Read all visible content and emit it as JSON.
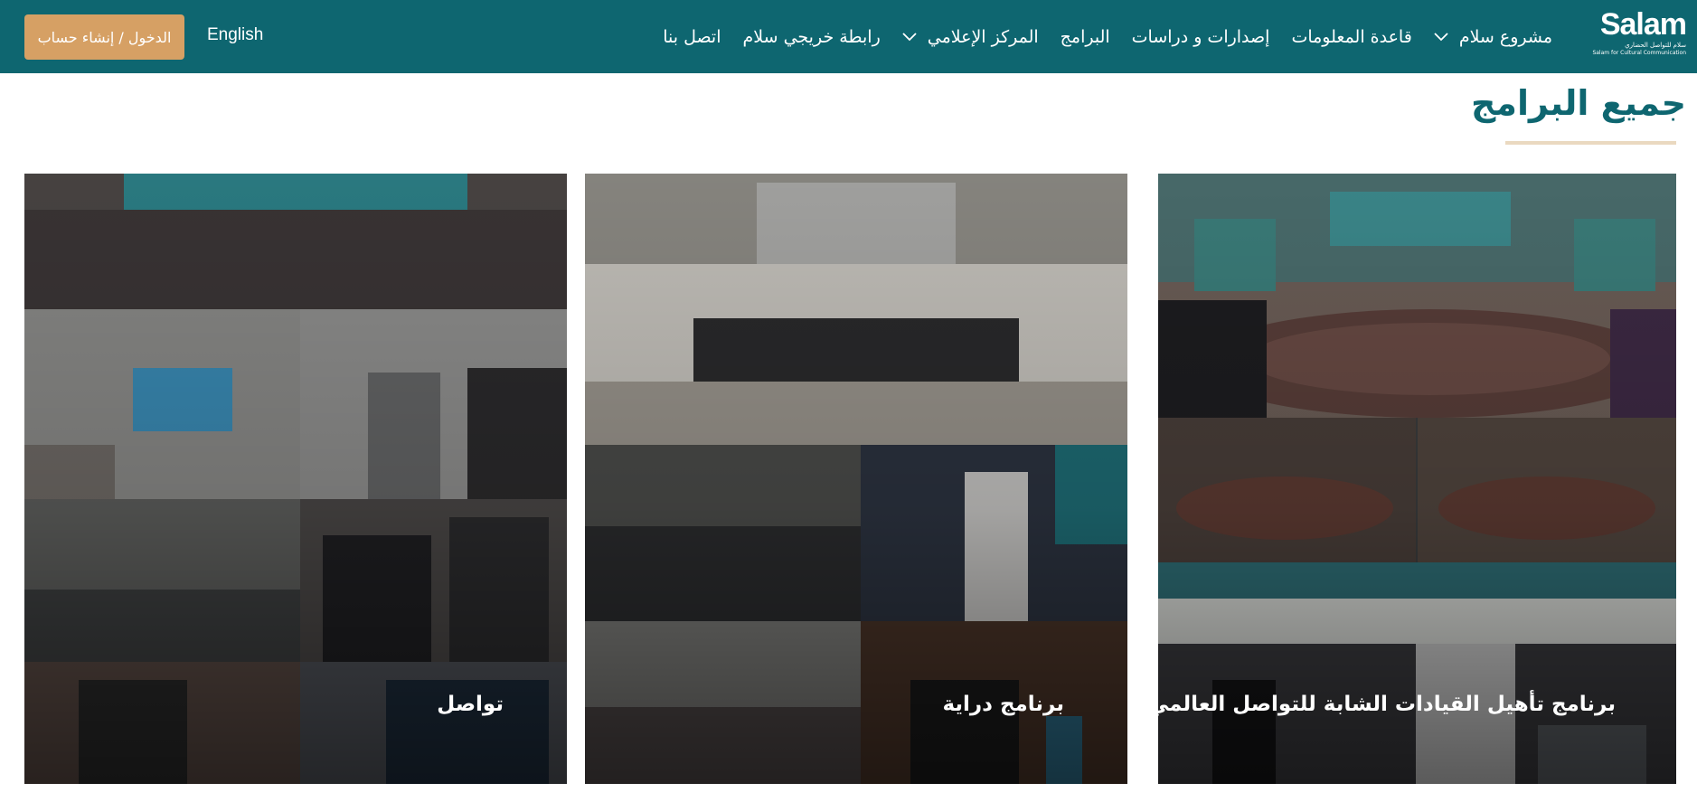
{
  "header": {
    "logo_word": "Salam",
    "logo_ar": "سلام للتواصل الحضاري",
    "logo_en": "Salam for Cultural Communication",
    "nav": [
      {
        "label": "مشروع سلام",
        "has_dropdown": true
      },
      {
        "label": "قاعدة المعلومات",
        "has_dropdown": false
      },
      {
        "label": "إصدارات و دراسات",
        "has_dropdown": false
      },
      {
        "label": "البرامج",
        "has_dropdown": false
      },
      {
        "label": "المركز الإعلامي",
        "has_dropdown": true
      },
      {
        "label": "رابطة خريجي سلام",
        "has_dropdown": false
      },
      {
        "label": "اتصل بنا",
        "has_dropdown": false
      }
    ],
    "language_link": "English",
    "login_button": "الدخول / إنشاء حساب"
  },
  "page": {
    "title": "جميع البرامج"
  },
  "programs": [
    {
      "title": "برنامج تأهيل القيادات الشابة للتواصل العالمي"
    },
    {
      "title": "برنامج دراية"
    },
    {
      "title": "تواصل"
    }
  ],
  "colors": {
    "header_bg": "#0e6670",
    "title_color": "#0e6670",
    "button_bg": "#d6a064",
    "underline": "#ead9c0"
  }
}
